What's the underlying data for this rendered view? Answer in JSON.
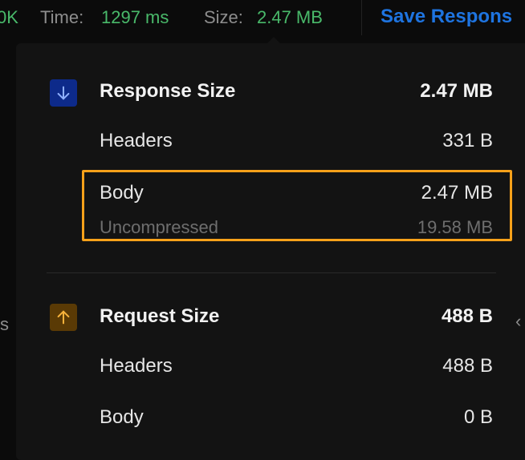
{
  "topbar": {
    "status": "0K",
    "time_label": "Time:",
    "time_value": "1297 ms",
    "size_label": "Size:",
    "size_value": "2.47 MB",
    "save_label": "Save Respons"
  },
  "side": {
    "left_text": "s"
  },
  "response": {
    "title": "Response Size",
    "total": "2.47 MB",
    "headers_label": "Headers",
    "headers_value": "331 B",
    "body_label": "Body",
    "body_value": "2.47 MB",
    "uncompressed_label": "Uncompressed",
    "uncompressed_value": "19.58 MB",
    "icon": "arrow-down-icon"
  },
  "request": {
    "title": "Request Size",
    "total": "488 B",
    "headers_label": "Headers",
    "headers_value": "488 B",
    "body_label": "Body",
    "body_value": "0 B",
    "icon": "arrow-up-icon"
  },
  "colors": {
    "success": "#49b96a",
    "link": "#1e74e0",
    "highlight": "#f7a11a",
    "down_icon_bg": "#0d2a8a",
    "up_icon_bg": "#5a3a05"
  }
}
